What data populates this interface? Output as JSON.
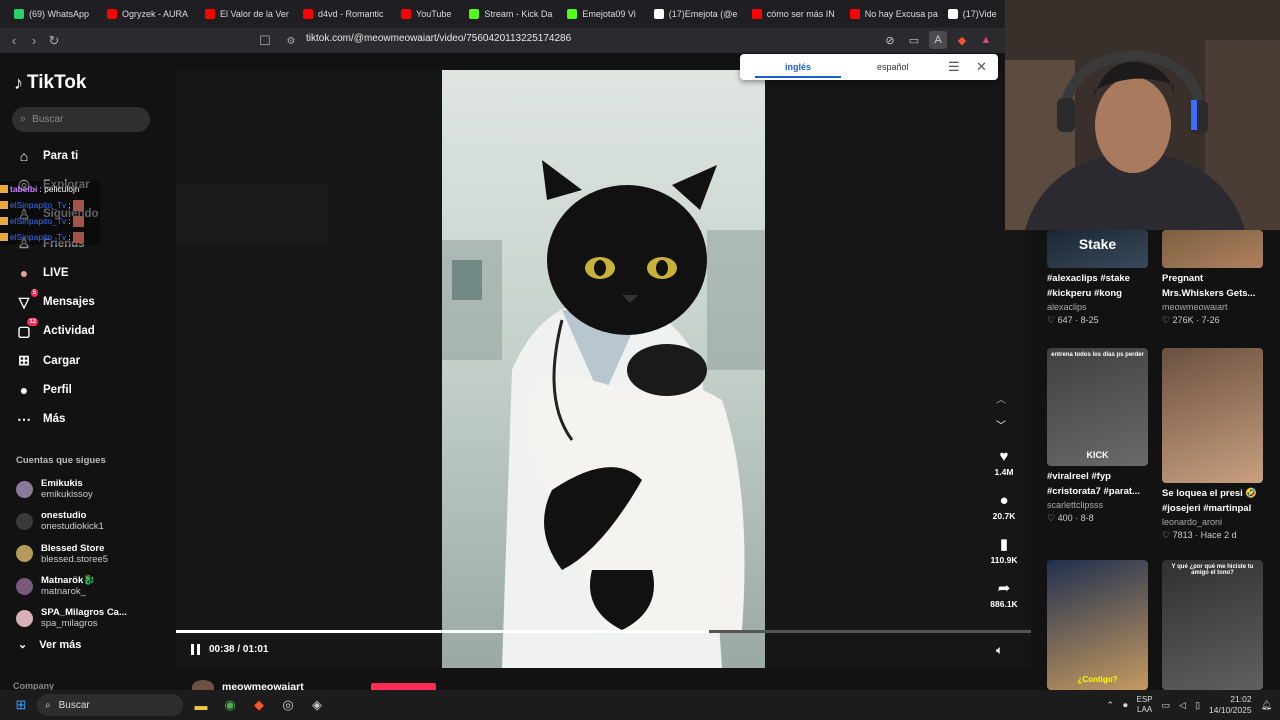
{
  "browser": {
    "tabs": [
      {
        "label": "(69) WhatsApp",
        "color": "#25d366"
      },
      {
        "label": "Ogryzek - AURA",
        "color": "#ff0000"
      },
      {
        "label": "El Valor de la Ver",
        "color": "#ff0000"
      },
      {
        "label": "d4vd - Romantic",
        "color": "#ff0000"
      },
      {
        "label": "YouTube",
        "color": "#ff0000"
      },
      {
        "label": "Stream - Kick Da",
        "color": "#53fc18"
      },
      {
        "label": "Emejota09 Vi",
        "color": "#53fc18"
      },
      {
        "label": "(17)Emejota (@e",
        "color": "#ffffff"
      },
      {
        "label": "cómo ser más IN",
        "color": "#ff0000"
      },
      {
        "label": "No hay Excusa pa",
        "color": "#ff0000"
      },
      {
        "label": "(17)Vide",
        "color": "#ffffff"
      }
    ],
    "url": "tiktok.com/@meowmeowaiart/video/7560420113225174286"
  },
  "translate": {
    "active_lang": "inglés",
    "other_lang": "español"
  },
  "tiktok": {
    "logo": "TikTok",
    "search_placeholder": "Buscar",
    "nav": [
      {
        "label": "Para ti",
        "icon": "home-icon"
      },
      {
        "label": "Explorar",
        "icon": "compass-icon"
      },
      {
        "label": "Siguiendo",
        "icon": "user-follow-icon"
      },
      {
        "label": "Friends",
        "icon": "friends-icon"
      },
      {
        "label": "LIVE",
        "icon": "live-icon"
      },
      {
        "label": "Mensajes",
        "icon": "message-icon",
        "badge": "5"
      },
      {
        "label": "Actividad",
        "icon": "activity-icon",
        "badge": "12"
      },
      {
        "label": "Cargar",
        "icon": "upload-icon"
      },
      {
        "label": "Perfil",
        "icon": "profile-icon"
      },
      {
        "label": "Más",
        "icon": "more-icon"
      }
    ],
    "following_title": "Cuentas que sigues",
    "following": [
      {
        "name": "Emikukis",
        "handle": "emikukissoy",
        "color": "#8a7a9a"
      },
      {
        "name": "onestudio",
        "handle": "onestudiokick1",
        "color": "#3a3a3a"
      },
      {
        "name": "Blessed Store",
        "handle": "blessed.storee5",
        "color": "#b59b5c"
      },
      {
        "name": "Matnarök🐉",
        "handle": "matnarok_",
        "color": "#7a5a7a"
      },
      {
        "name": "SPA_Milagros Ca...",
        "handle": "spa_milagros",
        "color": "#d8b0b8"
      }
    ],
    "see_more": "Ver más",
    "company": "Company"
  },
  "chat_overlay": [
    {
      "user": "tabelbi",
      "text": ": peliculojn"
    },
    {
      "user": "elSinpapito_Tv",
      "text": ":"
    },
    {
      "user": "elSinpapito_Tv",
      "text": ":"
    },
    {
      "user": "elSinpapito_Tv",
      "text": ":"
    }
  ],
  "player": {
    "time": "00:38 / 01:01",
    "progress": 0.623,
    "likes": "1.4M",
    "comments": "20.7K",
    "saves": "110.9K",
    "shares": "886.1K",
    "author": "meowmeowaiart"
  },
  "related": [
    {
      "title": "#alexaclips #stake",
      "title2": "#kickperu #kong",
      "author": "alexaclips",
      "stats": "647 · 8-25",
      "thumb_text": "Stake"
    },
    {
      "title": "Pregnant",
      "title2": "Mrs.Whiskers Gets...",
      "author": "meowmeowaiart",
      "stats": "276K · 7-26"
    },
    {
      "title": "#viralreel #fyp",
      "title2": "#cristorata7 #parat...",
      "author": "scarlettclipsss",
      "stats": "400 · 8-8",
      "thumb_top": "entrena todos los días ps perder",
      "thumb_text": "KICK"
    },
    {
      "title": "Se loquea el presi 🤣",
      "title2": "#josejeri #martinpal",
      "author": "leonardo_aroni",
      "stats": "7813 · Hace 2 d"
    },
    {
      "title": "",
      "title2": "",
      "author": "",
      "stats": "",
      "thumb_text": "¿Contigo?"
    },
    {
      "title": "",
      "title2": "",
      "author": "",
      "stats": "",
      "thumb_top": "Y qué ¿por qué me hiciste tu amigo el tono?"
    }
  ],
  "taskbar": {
    "search": "Buscar",
    "lang1": "ESP",
    "lang2": "LAA",
    "time": "21:02",
    "date": "14/10/2025"
  }
}
